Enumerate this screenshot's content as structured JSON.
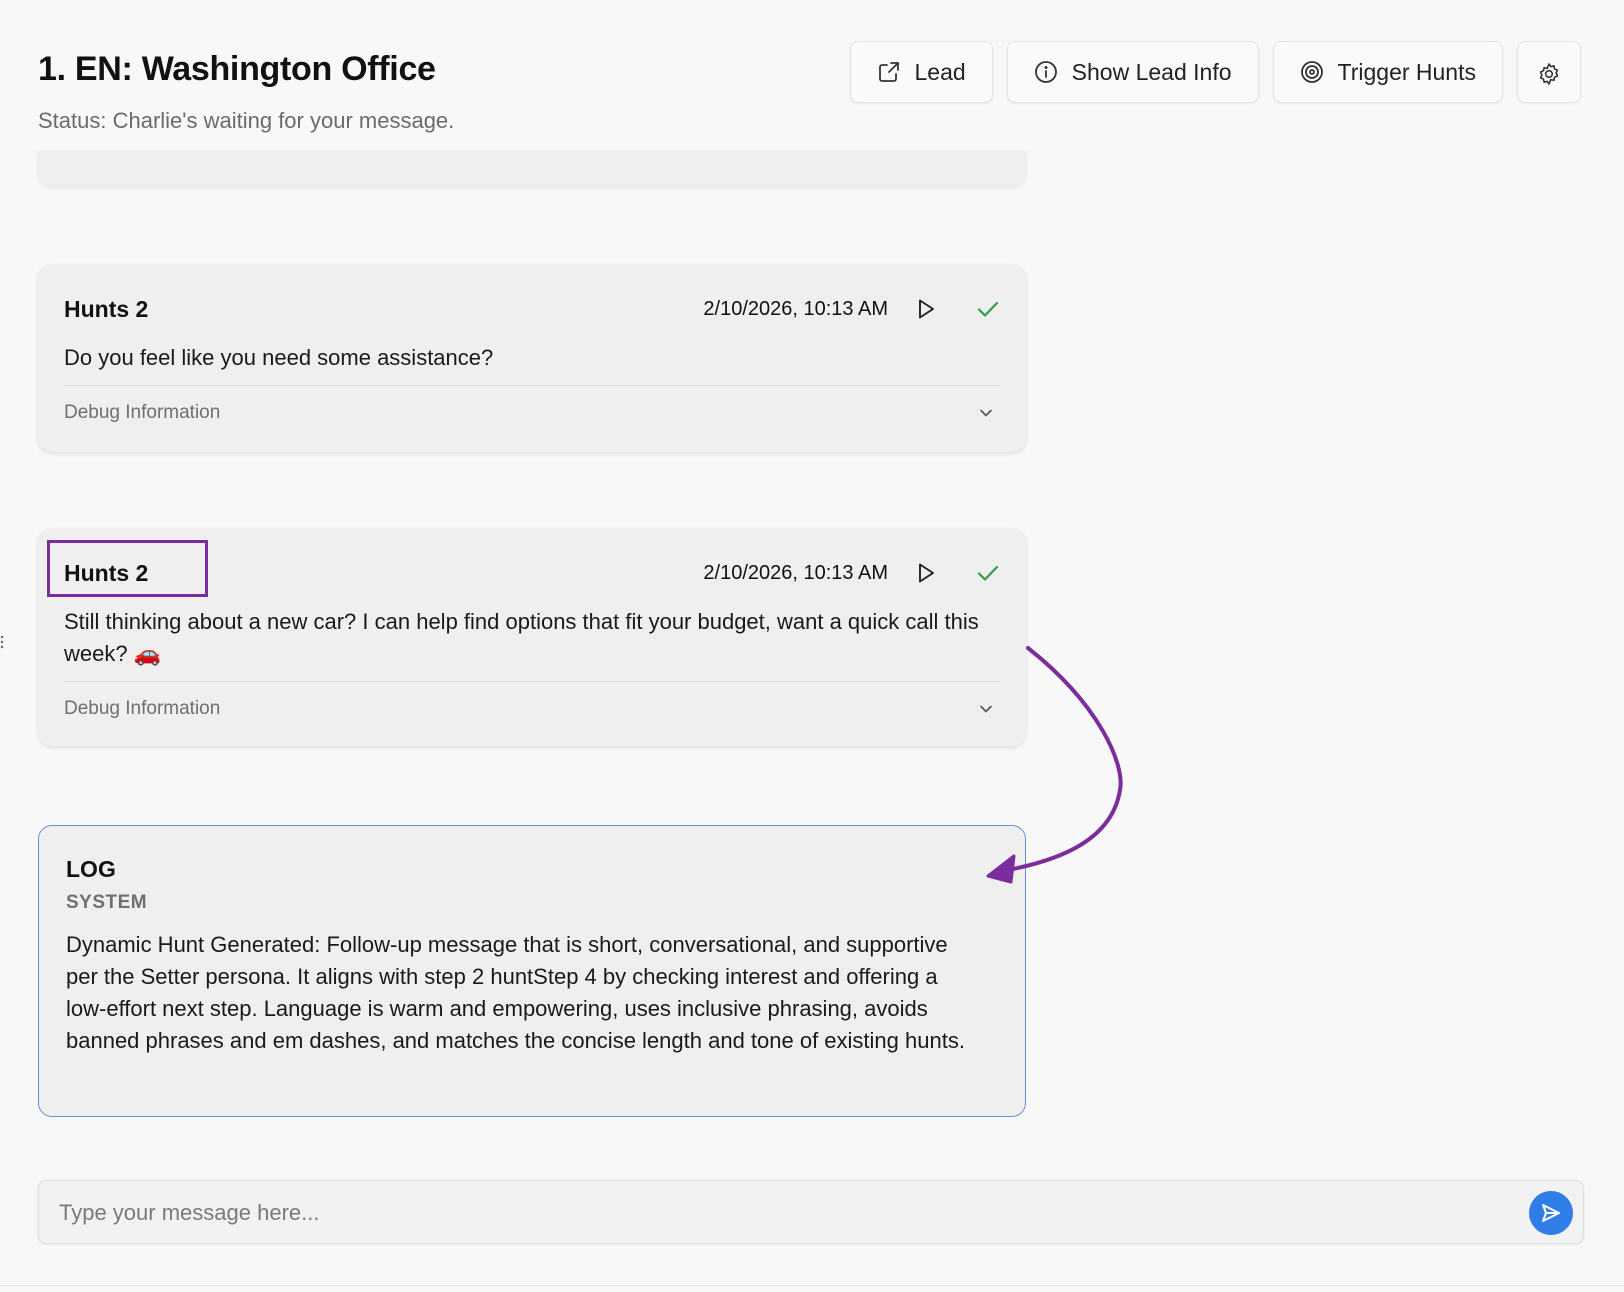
{
  "header": {
    "title": "1. EN: Washington Office",
    "status": "Status: Charlie's waiting for your message."
  },
  "toolbar": {
    "lead_label": "Lead",
    "lead_icon": "external-link-icon",
    "show_lead_info_label": "Show Lead Info",
    "show_lead_info_icon": "info-icon",
    "trigger_hunts_label": "Trigger Hunts",
    "trigger_hunts_icon": "target-icon",
    "settings_icon": "gear-icon"
  },
  "messages": [
    {
      "title": "Hunts 2",
      "timestamp": "2/10/2026, 10:13 AM",
      "text": "Do you feel like you need some assistance?",
      "debug_label": "Debug Information",
      "status_icon": "check-icon"
    },
    {
      "title": "Hunts 2",
      "timestamp": "2/10/2026, 10:13 AM",
      "text": "Still thinking about a new car? I can help find options that fit your budget, want a quick call this week? 🚗",
      "debug_label": "Debug Information",
      "status_icon": "check-icon"
    }
  ],
  "log": {
    "title": "LOG",
    "source": "SYSTEM",
    "text": "Dynamic Hunt Generated: Follow-up message that is short, conversational, and supportive per the Setter persona. It aligns with step 2 huntStep 4 by checking interest and offering a low-effort next step. Language is warm and empowering, uses inclusive phrasing, avoids banned phrases and em dashes, and matches the concise length and tone of existing hunts."
  },
  "composer": {
    "placeholder": "Type your message here...",
    "value": ""
  },
  "colors": {
    "annotation": "#7b2d9e",
    "log_border": "#6a8fd8",
    "send_button": "#2f7ee8",
    "check": "#2e9e47"
  }
}
